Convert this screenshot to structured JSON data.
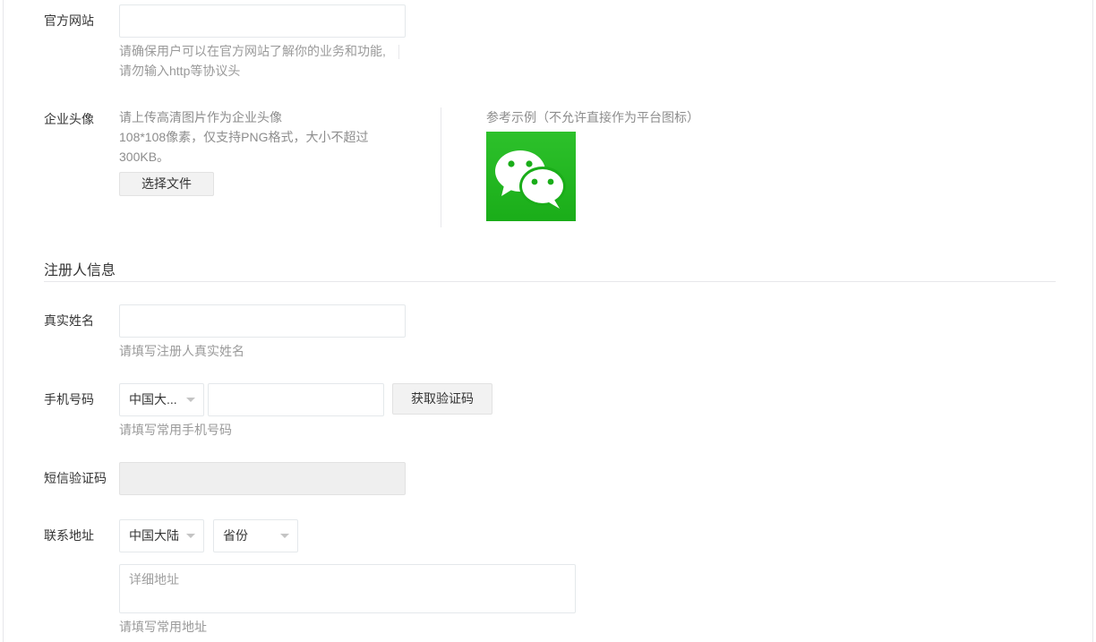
{
  "website": {
    "label": "官方网站",
    "value": "",
    "hint_line1": "请确保用户可以在官方网站了解你的业务和功能,",
    "hint_line2": "请勿输入http等协议头"
  },
  "avatar": {
    "label": "企业头像",
    "hint_line1": "请上传高清图片作为企业头像",
    "hint_line2": "108*108像素，仅支持PNG格式，大小不超过",
    "hint_line3": "300KB。",
    "choose_file_label": "选择文件",
    "example_label": "参考示例（不允许直接作为平台图标）",
    "example_icon": "wechat-logo",
    "example_color": "#1aad19"
  },
  "registrant": {
    "section_title": "注册人信息",
    "name": {
      "label": "真实姓名",
      "value": "",
      "hint": "请填写注册人真实姓名"
    },
    "phone": {
      "label": "手机号码",
      "region_selected": "中国大...",
      "value": "",
      "get_code_label": "获取验证码",
      "hint": "请填写常用手机号码"
    },
    "sms": {
      "label": "短信验证码",
      "value": ""
    },
    "address": {
      "label": "联系地址",
      "country_selected": "中国大陆",
      "province_selected": "省份",
      "detail_placeholder": "详细地址",
      "hint": "请填写常用地址"
    }
  }
}
